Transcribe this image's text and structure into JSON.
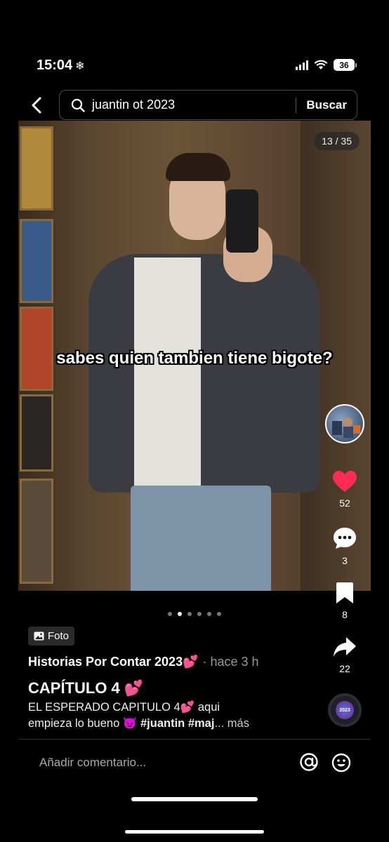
{
  "status_bar": {
    "time": "15:04",
    "weather_icon": "snowflake-icon",
    "battery": "36"
  },
  "search": {
    "query": "juantin ot 2023",
    "button_label": "Buscar"
  },
  "photo": {
    "page_counter": "13 / 35",
    "overlay_caption": "sabes quien tambien tiene bigote?"
  },
  "actions": {
    "likes": "52",
    "comments": "3",
    "saves": "8",
    "shares": "22"
  },
  "carousel": {
    "total_dots": 6,
    "active_index": 1
  },
  "post": {
    "type_badge": "Foto",
    "author": "Historias Por Contar 2023💕",
    "time_ago": "· hace 3 h",
    "title": "CAPÍTULO 4 💕",
    "description_line1": "EL ESPERADO CAPITULO 4💕 aqui",
    "description_line2_text": "empieza lo bueno 😈",
    "hashtags": "#juantin #maj",
    "more_label": "... más",
    "disc_label": "2023"
  },
  "comment_bar": {
    "placeholder": "Añadir comentario..."
  },
  "colors": {
    "like": "#fe2c55",
    "background": "#000000"
  }
}
